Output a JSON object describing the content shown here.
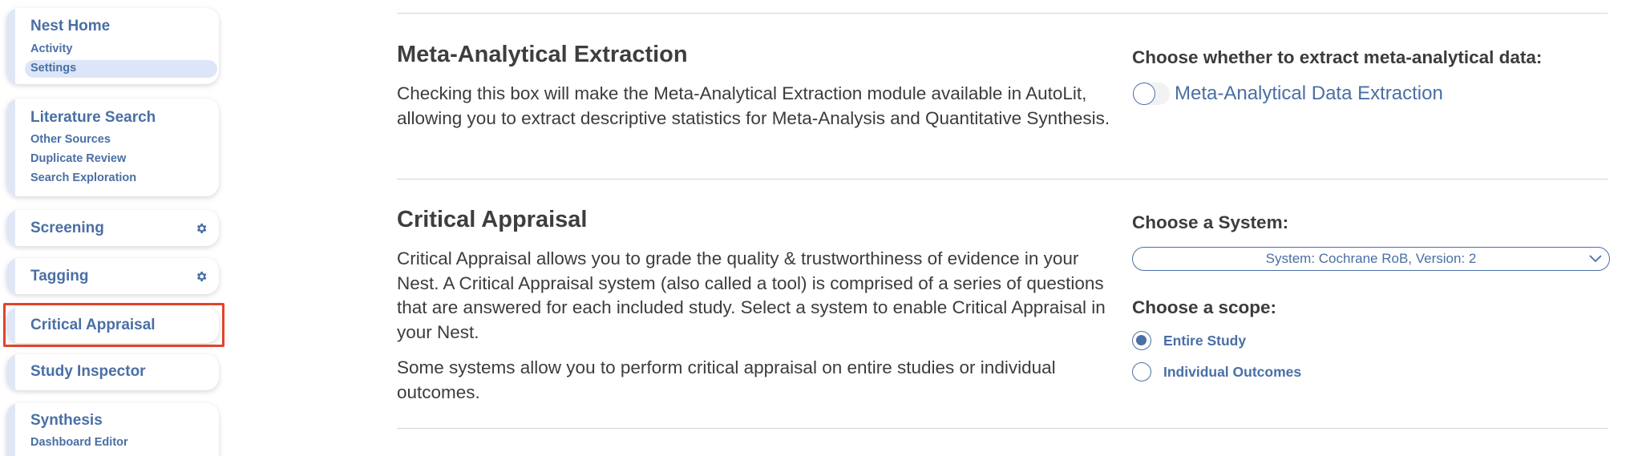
{
  "sidebar": {
    "nest_home": {
      "title": "Nest Home",
      "items": [
        "Activity",
        "Settings"
      ],
      "active_item": "Settings"
    },
    "literature_search": {
      "title": "Literature Search",
      "items": [
        "Other Sources",
        "Duplicate Review",
        "Search Exploration"
      ]
    },
    "screening": {
      "title": "Screening",
      "icon": "gear-icon"
    },
    "tagging": {
      "title": "Tagging",
      "icon": "gear-icon"
    },
    "critical_appraisal": {
      "title": "Critical Appraisal",
      "highlighted": true
    },
    "study_inspector": {
      "title": "Study Inspector"
    },
    "synthesis": {
      "title": "Synthesis",
      "items": [
        "Dashboard Editor"
      ]
    }
  },
  "meta": {
    "title": "Meta-Analytical Extraction",
    "description": "Checking this box will make the Meta-Analytical Extraction module available in AutoLit, allowing you to extract descriptive statistics for Meta-Analysis and Quantitative Synthesis.",
    "choose_label": "Choose whether to extract meta-analytical data:",
    "toggle_label": "Meta-Analytical Data Extraction",
    "toggle_on": false
  },
  "critical": {
    "title": "Critical Appraisal",
    "description1": "Critical Appraisal allows you to grade the quality & trustworthiness of evidence in your Nest. A Critical Appraisal system (also called a tool) is comprised of a series of questions that are answered for each included study. Select a system to enable Critical Appraisal in your Nest.",
    "description2": "Some systems allow you to perform critical appraisal on entire studies or individual outcomes.",
    "system_label": "Choose a System:",
    "system_value": "System: Cochrane RoB, Version: 2",
    "scope_label": "Choose a scope:",
    "scope_options": [
      "Entire Study",
      "Individual Outcomes"
    ],
    "scope_selected": "Entire Study"
  },
  "colors": {
    "accent": "#4a6fa5",
    "highlight": "#e0442a",
    "active_bg": "#dce6f8"
  }
}
